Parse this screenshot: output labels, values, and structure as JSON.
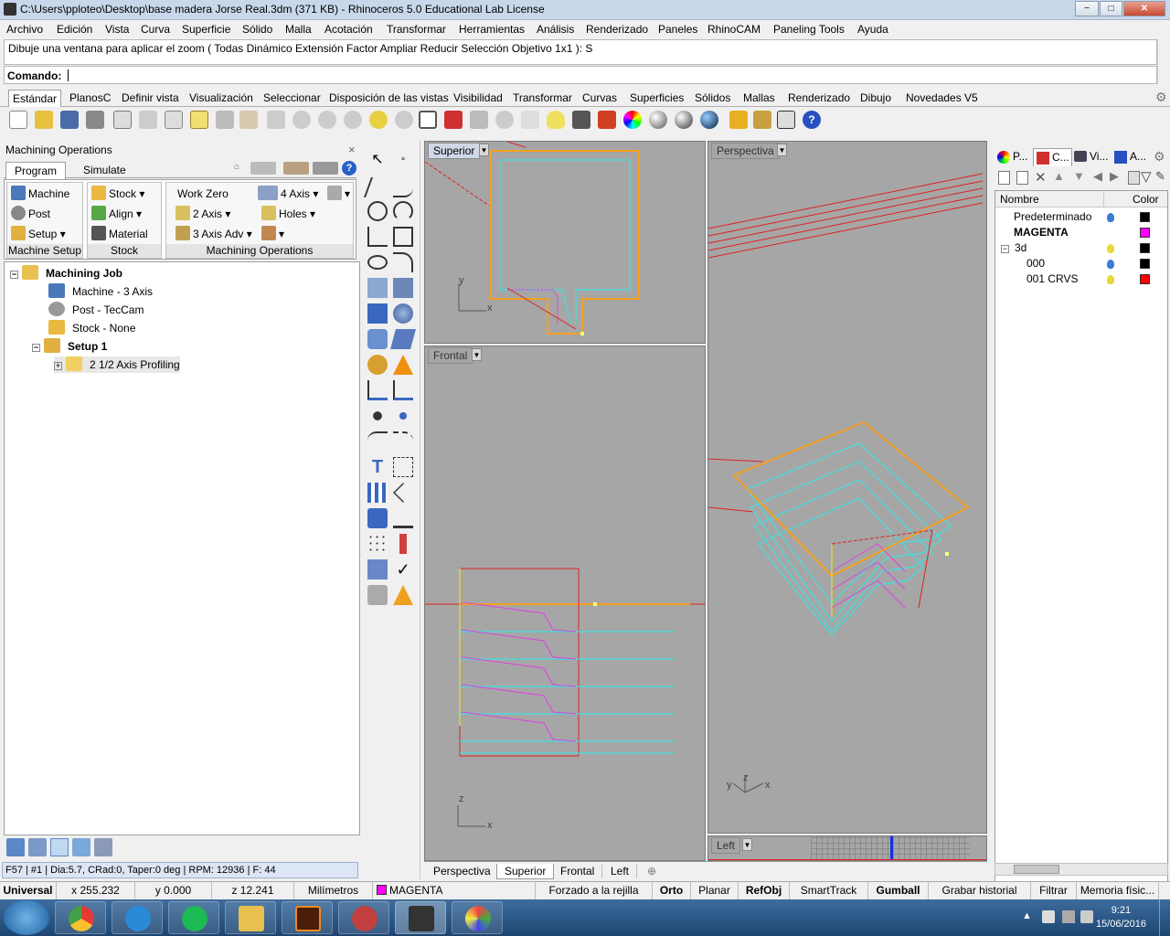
{
  "window": {
    "title": "C:\\Users\\pploteo\\Desktop\\base madera Jorse Real.3dm (371 KB) - Rhinoceros 5.0 Educational Lab License",
    "min": "−",
    "max": "□",
    "close": "✕"
  },
  "menu": [
    "Archivo",
    "Edición",
    "Vista",
    "Curva",
    "Superficie",
    "Sólido",
    "Malla",
    "Acotación",
    "Transformar",
    "Herramientas",
    "Análisis",
    "Renderizado",
    "Paneles",
    "RhinoCAM",
    "Paneling Tools",
    "Ayuda"
  ],
  "command": {
    "history": "Dibuje una ventana para aplicar el zoom ( Todas  Dinámico  Extensión  Factor  Ampliar  Reducir  Selección  Objetivo  1x1 ): S",
    "prompt": "Comando:"
  },
  "toolbar_tabs": [
    "Estándar",
    "PlanosC",
    "Definir vista",
    "Visualización",
    "Seleccionar",
    "Disposición de las vistas",
    "Visibilidad",
    "Transformar",
    "Curvas",
    "Superficies",
    "Sólidos",
    "Mallas",
    "Renderizado",
    "Dibujo",
    "Novedades V5"
  ],
  "machining": {
    "header": "Machining Operations",
    "close": "×",
    "tabs": [
      "Program",
      "Simulate"
    ],
    "groups": {
      "setup": {
        "label": "Machine Setup",
        "buttons": [
          "Machine",
          "Post",
          "Setup"
        ]
      },
      "stock": {
        "label": "Stock",
        "buttons": [
          "Stock",
          "Align",
          "Material"
        ]
      },
      "ops": {
        "label": "Machining Operations",
        "buttons": [
          "Work Zero",
          "4 Axis",
          "Holes",
          "2 Axis",
          "3 Axis Adv"
        ]
      }
    },
    "tree": [
      {
        "label": "Machining Job",
        "bold": true
      },
      {
        "label": "Machine - 3 Axis"
      },
      {
        "label": "Post - TecCam"
      },
      {
        "label": "Stock - None"
      },
      {
        "label": "Setup 1",
        "bold": true
      },
      {
        "label": "2 1/2 Axis Profiling"
      }
    ],
    "status": "F57 | #1 | Dia:5.7, CRad:0, Taper:0 deg | RPM: 12936 | F: 44"
  },
  "viewports": {
    "top": "Superior",
    "perspective": "Perspectiva",
    "front": "Frontal",
    "left": "Left",
    "axis_y": "y",
    "axis_x": "x",
    "axis_z": "z"
  },
  "view_tabs": [
    "Perspectiva",
    "Superior",
    "Frontal",
    "Left"
  ],
  "view_tab_add": "⊕",
  "layers": {
    "tabs": [
      "P...",
      "C...",
      "Vi...",
      "A..."
    ],
    "col_name": "Nombre",
    "col_color": "Color",
    "rows": [
      {
        "name": "Predeterminado",
        "color": "#000000",
        "bulb": "#3a7bd5"
      },
      {
        "name": "MAGENTA",
        "color": "#ff00ff",
        "bold": true
      },
      {
        "name": "3d",
        "color": "#000000",
        "bulb": "#e8d838"
      },
      {
        "name": "000",
        "color": "#000000",
        "bulb": "#3a7bd5"
      },
      {
        "name": "001 CRVS",
        "color": "#ff0000",
        "bulb": "#e8d838"
      }
    ]
  },
  "statusbar": {
    "cplane": "Universal",
    "x": "x 255.232",
    "y": "y 0.000",
    "z": "z 12.241",
    "units": "Milímetros",
    "layer": "MAGENTA",
    "layer_color": "#ff00ff",
    "snap": "Forzado a la rejilla",
    "ortho": "Orto",
    "planar": "Planar",
    "osnap": "RefObj",
    "smarttrack": "SmartTrack",
    "gumball": "Gumball",
    "history": "Grabar historial",
    "filter": "Filtrar",
    "memory": "Memoria físic..."
  },
  "clock": {
    "time": "9:21",
    "date": "15/06/2016"
  },
  "colors": {
    "orange": "#f5a020",
    "cyan": "#40e0e0",
    "magenta": "#e040e0",
    "red": "#e02020",
    "yellow": "#e8e030",
    "viewport": "#a6a6a6"
  }
}
